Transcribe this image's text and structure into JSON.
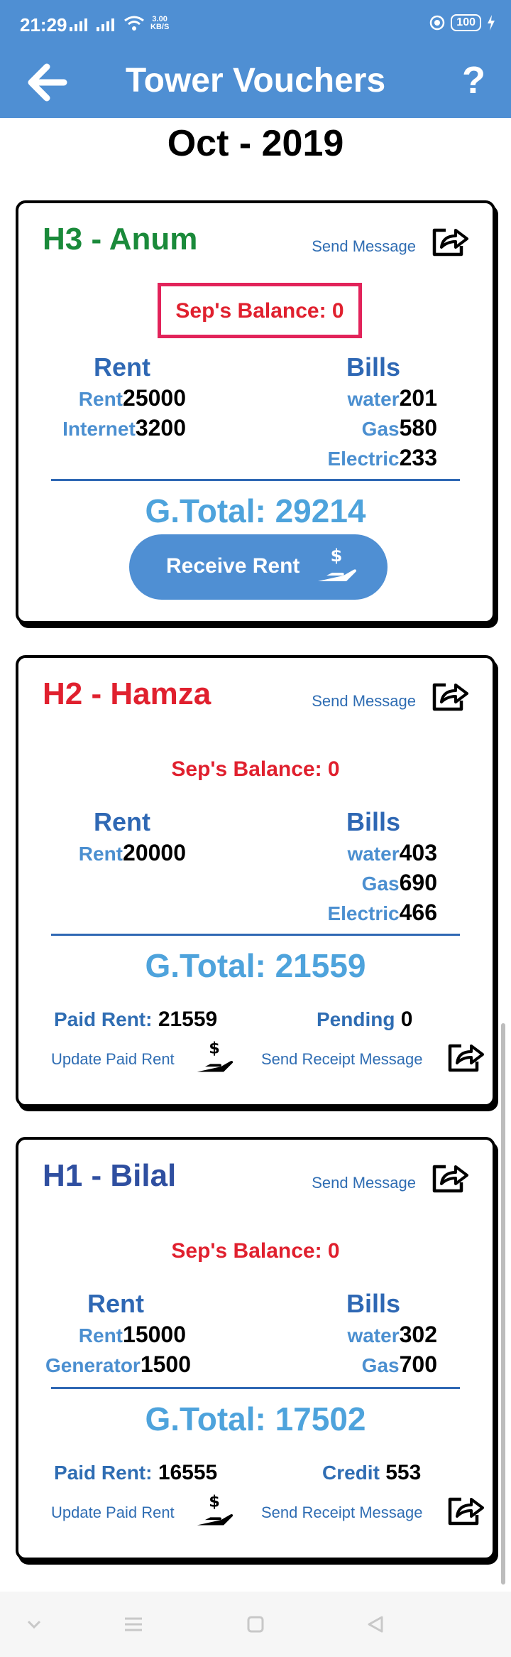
{
  "status": {
    "time": "21:29",
    "speed_value": "3.00",
    "speed_unit": "KB/S",
    "battery": "100"
  },
  "appbar": {
    "title": "Tower Vouchers",
    "help": "?"
  },
  "month": "Oct - 2019",
  "cards": [
    {
      "name": "H3 - Anum",
      "name_color": "#1a8a3a",
      "send_message": "Send Message",
      "balance": "Sep's Balance: 0",
      "rent_header": "Rent",
      "bills_header": "Bills",
      "rent_items": [
        {
          "label": "Rent",
          "value": "25000"
        },
        {
          "label": "Internet",
          "value": "3200"
        }
      ],
      "bill_items": [
        {
          "label": "water",
          "value": "201"
        },
        {
          "label": "Gas",
          "value": "580"
        },
        {
          "label": "Electric",
          "value": "233"
        }
      ],
      "gtotal": "G.Total: 29214",
      "receive_button": "Receive Rent"
    },
    {
      "name": "H2 - Hamza",
      "name_color": "#e0202e",
      "send_message": "Send Message",
      "balance": "Sep's Balance: 0",
      "rent_header": "Rent",
      "bills_header": "Bills",
      "rent_items": [
        {
          "label": "Rent",
          "value": "20000"
        }
      ],
      "bill_items": [
        {
          "label": "water",
          "value": "403"
        },
        {
          "label": "Gas",
          "value": "690"
        },
        {
          "label": "Electric",
          "value": "466"
        }
      ],
      "gtotal": "G.Total: 21559",
      "paid_label": "Paid Rent:",
      "paid_value": "21559",
      "status_label": "Pending",
      "status_value": "0",
      "update_paid": "Update Paid Rent",
      "send_receipt": "Send Receipt Message"
    },
    {
      "name": "H1 - Bilal",
      "name_color": "#2f4fa0",
      "send_message": "Send Message",
      "balance": "Sep's Balance: 0",
      "rent_header": "Rent",
      "bills_header": "Bills",
      "rent_items": [
        {
          "label": "Rent",
          "value": "15000"
        },
        {
          "label": "Generator",
          "value": "1500"
        }
      ],
      "bill_items": [
        {
          "label": "water",
          "value": "302"
        },
        {
          "label": "Gas",
          "value": "700"
        }
      ],
      "gtotal": "G.Total: 17502",
      "paid_label": "Paid Rent:",
      "paid_value": "16555",
      "status_label": "Credit",
      "status_value": "553",
      "update_paid": "Update Paid Rent",
      "send_receipt": "Send Receipt Message"
    }
  ],
  "colors": {
    "primary": "#4f8fd3",
    "balance_red": "#e0202e",
    "highlight_box": "#e2235a",
    "total_blue": "#4ea3dc"
  },
  "icons": {
    "back": "arrow-left-icon",
    "share": "share-icon",
    "hand": "hand-money-icon"
  }
}
